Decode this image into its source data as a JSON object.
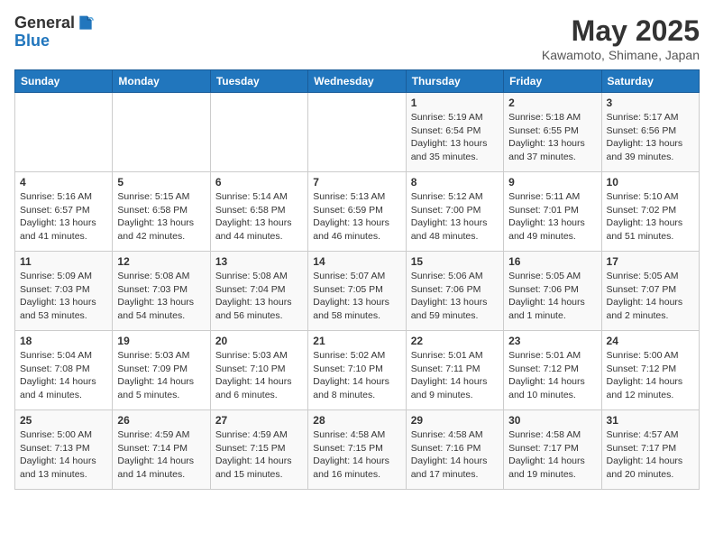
{
  "header": {
    "logo_line1": "General",
    "logo_line2": "Blue",
    "month_title": "May 2025",
    "location": "Kawamoto, Shimane, Japan"
  },
  "weekdays": [
    "Sunday",
    "Monday",
    "Tuesday",
    "Wednesday",
    "Thursday",
    "Friday",
    "Saturday"
  ],
  "weeks": [
    [
      {
        "day": "",
        "info": ""
      },
      {
        "day": "",
        "info": ""
      },
      {
        "day": "",
        "info": ""
      },
      {
        "day": "",
        "info": ""
      },
      {
        "day": "1",
        "info": "Sunrise: 5:19 AM\nSunset: 6:54 PM\nDaylight: 13 hours\nand 35 minutes."
      },
      {
        "day": "2",
        "info": "Sunrise: 5:18 AM\nSunset: 6:55 PM\nDaylight: 13 hours\nand 37 minutes."
      },
      {
        "day": "3",
        "info": "Sunrise: 5:17 AM\nSunset: 6:56 PM\nDaylight: 13 hours\nand 39 minutes."
      }
    ],
    [
      {
        "day": "4",
        "info": "Sunrise: 5:16 AM\nSunset: 6:57 PM\nDaylight: 13 hours\nand 41 minutes."
      },
      {
        "day": "5",
        "info": "Sunrise: 5:15 AM\nSunset: 6:58 PM\nDaylight: 13 hours\nand 42 minutes."
      },
      {
        "day": "6",
        "info": "Sunrise: 5:14 AM\nSunset: 6:58 PM\nDaylight: 13 hours\nand 44 minutes."
      },
      {
        "day": "7",
        "info": "Sunrise: 5:13 AM\nSunset: 6:59 PM\nDaylight: 13 hours\nand 46 minutes."
      },
      {
        "day": "8",
        "info": "Sunrise: 5:12 AM\nSunset: 7:00 PM\nDaylight: 13 hours\nand 48 minutes."
      },
      {
        "day": "9",
        "info": "Sunrise: 5:11 AM\nSunset: 7:01 PM\nDaylight: 13 hours\nand 49 minutes."
      },
      {
        "day": "10",
        "info": "Sunrise: 5:10 AM\nSunset: 7:02 PM\nDaylight: 13 hours\nand 51 minutes."
      }
    ],
    [
      {
        "day": "11",
        "info": "Sunrise: 5:09 AM\nSunset: 7:03 PM\nDaylight: 13 hours\nand 53 minutes."
      },
      {
        "day": "12",
        "info": "Sunrise: 5:08 AM\nSunset: 7:03 PM\nDaylight: 13 hours\nand 54 minutes."
      },
      {
        "day": "13",
        "info": "Sunrise: 5:08 AM\nSunset: 7:04 PM\nDaylight: 13 hours\nand 56 minutes."
      },
      {
        "day": "14",
        "info": "Sunrise: 5:07 AM\nSunset: 7:05 PM\nDaylight: 13 hours\nand 58 minutes."
      },
      {
        "day": "15",
        "info": "Sunrise: 5:06 AM\nSunset: 7:06 PM\nDaylight: 13 hours\nand 59 minutes."
      },
      {
        "day": "16",
        "info": "Sunrise: 5:05 AM\nSunset: 7:06 PM\nDaylight: 14 hours\nand 1 minute."
      },
      {
        "day": "17",
        "info": "Sunrise: 5:05 AM\nSunset: 7:07 PM\nDaylight: 14 hours\nand 2 minutes."
      }
    ],
    [
      {
        "day": "18",
        "info": "Sunrise: 5:04 AM\nSunset: 7:08 PM\nDaylight: 14 hours\nand 4 minutes."
      },
      {
        "day": "19",
        "info": "Sunrise: 5:03 AM\nSunset: 7:09 PM\nDaylight: 14 hours\nand 5 minutes."
      },
      {
        "day": "20",
        "info": "Sunrise: 5:03 AM\nSunset: 7:10 PM\nDaylight: 14 hours\nand 6 minutes."
      },
      {
        "day": "21",
        "info": "Sunrise: 5:02 AM\nSunset: 7:10 PM\nDaylight: 14 hours\nand 8 minutes."
      },
      {
        "day": "22",
        "info": "Sunrise: 5:01 AM\nSunset: 7:11 PM\nDaylight: 14 hours\nand 9 minutes."
      },
      {
        "day": "23",
        "info": "Sunrise: 5:01 AM\nSunset: 7:12 PM\nDaylight: 14 hours\nand 10 minutes."
      },
      {
        "day": "24",
        "info": "Sunrise: 5:00 AM\nSunset: 7:12 PM\nDaylight: 14 hours\nand 12 minutes."
      }
    ],
    [
      {
        "day": "25",
        "info": "Sunrise: 5:00 AM\nSunset: 7:13 PM\nDaylight: 14 hours\nand 13 minutes."
      },
      {
        "day": "26",
        "info": "Sunrise: 4:59 AM\nSunset: 7:14 PM\nDaylight: 14 hours\nand 14 minutes."
      },
      {
        "day": "27",
        "info": "Sunrise: 4:59 AM\nSunset: 7:15 PM\nDaylight: 14 hours\nand 15 minutes."
      },
      {
        "day": "28",
        "info": "Sunrise: 4:58 AM\nSunset: 7:15 PM\nDaylight: 14 hours\nand 16 minutes."
      },
      {
        "day": "29",
        "info": "Sunrise: 4:58 AM\nSunset: 7:16 PM\nDaylight: 14 hours\nand 17 minutes."
      },
      {
        "day": "30",
        "info": "Sunrise: 4:58 AM\nSunset: 7:17 PM\nDaylight: 14 hours\nand 19 minutes."
      },
      {
        "day": "31",
        "info": "Sunrise: 4:57 AM\nSunset: 7:17 PM\nDaylight: 14 hours\nand 20 minutes."
      }
    ]
  ]
}
